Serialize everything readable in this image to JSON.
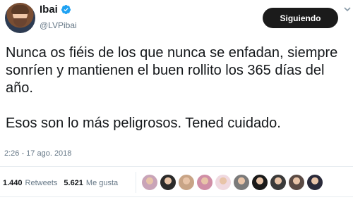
{
  "author": {
    "display_name": "Ibai",
    "handle": "@LVPibai"
  },
  "follow_button": {
    "label": "Siguiendo"
  },
  "tweet": {
    "paragraph_1": "Nunca os fiéis de los que nunca se enfadan, siempre sonríen y mantienen el buen rollito los 365 días del año.",
    "paragraph_2": "Esos son lo más peligrosos. Tened cuidado.",
    "timestamp": "2:26 - 17 ago. 2018"
  },
  "stats": {
    "retweets_count": "1.440",
    "retweets_label": "Retweets",
    "likes_count": "5.621",
    "likes_label": "Me gusta"
  },
  "likers": [
    {
      "icon": "avatar-1",
      "color": "#c9a4b8"
    },
    {
      "icon": "avatar-2",
      "color": "#2b2b2b"
    },
    {
      "icon": "avatar-3",
      "color": "#c8a486"
    },
    {
      "icon": "avatar-4",
      "color": "#d08ea6"
    },
    {
      "icon": "avatar-5",
      "color": "#f0d9e0"
    },
    {
      "icon": "avatar-6",
      "color": "#7a7a7a"
    },
    {
      "icon": "avatar-7",
      "color": "#1a1a1a"
    },
    {
      "icon": "avatar-8",
      "color": "#3a3a3a"
    },
    {
      "icon": "avatar-9",
      "color": "#5a4a44"
    },
    {
      "icon": "avatar-10",
      "color": "#2a2a3a"
    }
  ],
  "colors": {
    "verified": "#1da1f2",
    "follow_bg": "#1b1b1b",
    "muted": "#657786"
  }
}
